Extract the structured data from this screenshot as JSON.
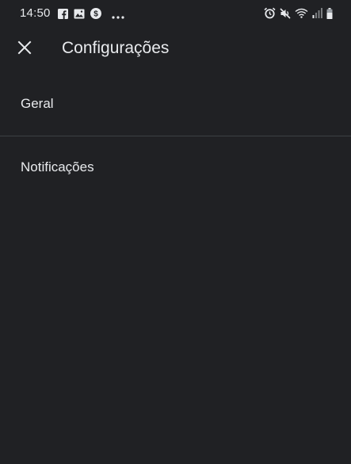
{
  "status_bar": {
    "time": "14:50",
    "left_icons": [
      "facebook-icon",
      "gallery-icon",
      "dollar-icon",
      "more-dots-icon"
    ],
    "right_icons": [
      "alarm-icon",
      "mute-icon",
      "wifi-icon",
      "signal-icon",
      "battery-icon"
    ]
  },
  "app_bar": {
    "close_icon": "close-icon",
    "title": "Configurações"
  },
  "settings": {
    "items": [
      {
        "label": "Geral"
      },
      {
        "label": "Notificações"
      }
    ]
  },
  "colors": {
    "background": "#202124",
    "text": "#e8eaed",
    "divider": "#3c4043"
  }
}
